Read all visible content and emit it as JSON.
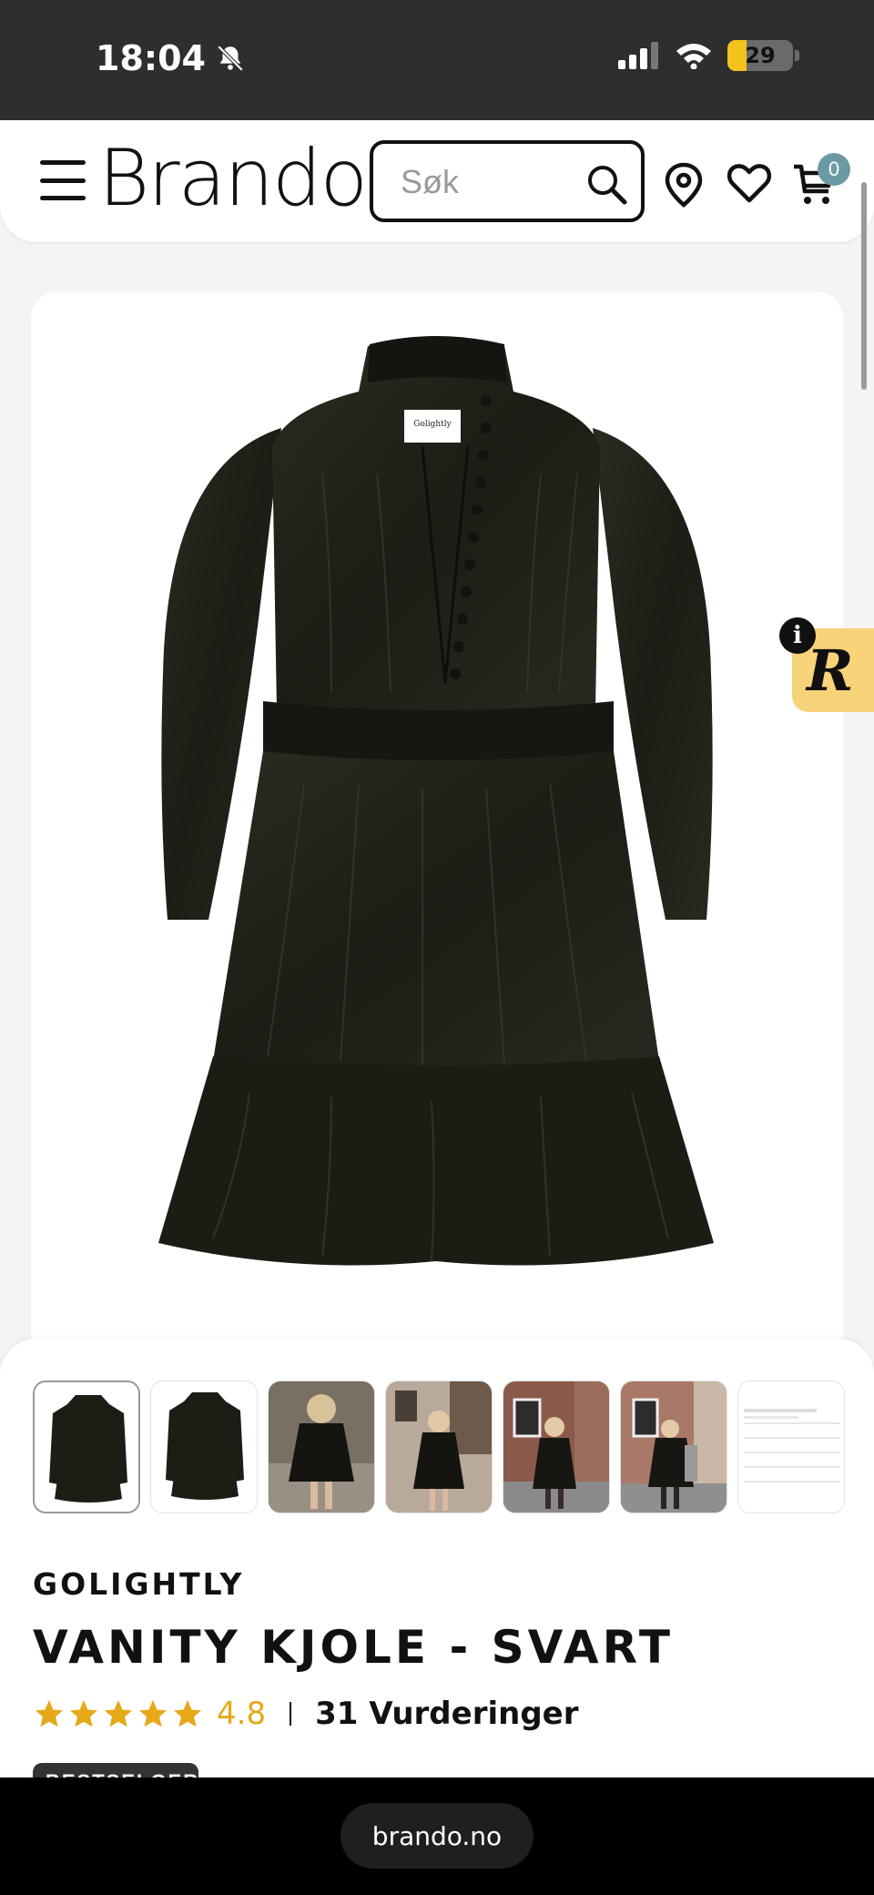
{
  "status_bar": {
    "time": "18:04",
    "battery_level": "29"
  },
  "header": {
    "logo": "Brando",
    "search_placeholder": "Søk",
    "cart_count": "0",
    "icons": [
      "menu-icon",
      "search-icon",
      "location-pin-icon",
      "heart-icon",
      "cart-icon"
    ]
  },
  "product": {
    "brand": "GOLIGHTLY",
    "title": "VANITY KJOLE - SVART",
    "rating": "4.8",
    "stars": 5,
    "reviews": "31 Vurderinger",
    "badge": "BESTSELGER",
    "main_image": "black-dress-product-photo",
    "thumbnails": [
      {
        "name": "dress-front-thumb",
        "active": true
      },
      {
        "name": "dress-back-thumb",
        "active": false
      },
      {
        "name": "model-photo-1-thumb",
        "active": false
      },
      {
        "name": "model-photo-2-thumb",
        "active": false
      },
      {
        "name": "model-photo-3-thumb",
        "active": false
      },
      {
        "name": "model-photo-4-thumb",
        "active": false
      },
      {
        "name": "size-chart-thumb",
        "active": false
      }
    ]
  },
  "chat_widget": {
    "letter": "R",
    "info": "i"
  },
  "browser": {
    "url": "brando.no"
  },
  "colors": {
    "accent_star": "#e6a817",
    "cart_badge": "#6c9aa4",
    "chat_widget": "#f9d37a"
  }
}
